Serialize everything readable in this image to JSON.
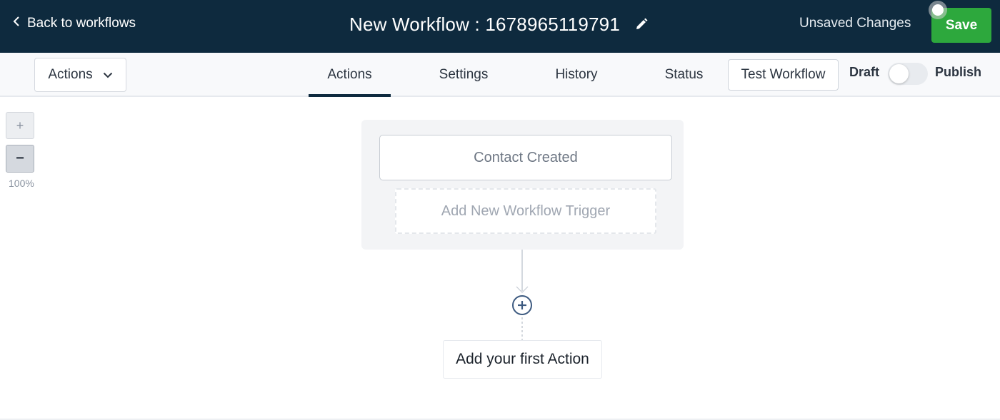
{
  "header": {
    "back_label": "Back to workflows",
    "title": "New Workflow : 1678965119791",
    "unsaved_label": "Unsaved Changes",
    "save_label": "Save"
  },
  "toolbar": {
    "actions_dropdown": "Actions",
    "tabs": [
      {
        "label": "Actions",
        "active": true
      },
      {
        "label": "Settings",
        "active": false
      },
      {
        "label": "History",
        "active": false
      },
      {
        "label": "Status",
        "active": false
      }
    ],
    "test_label": "Test Workflow",
    "draft_label": "Draft",
    "publish_label": "Publish",
    "published": false
  },
  "canvas": {
    "zoom_in_label": "+",
    "zoom_out_label": "−",
    "zoom_level": "100%",
    "trigger": "Contact Created",
    "add_trigger_label": "Add New Workflow Trigger",
    "first_action_label": "Add your first Action"
  },
  "icons": {
    "back": "chevron-left-icon",
    "edit": "pencil-icon",
    "dropdown": "chevron-down-icon",
    "add": "plus-circle-icon"
  },
  "colors": {
    "header_bg": "#0e2a3e",
    "save_green": "#2da83d",
    "active_tab_underline": "#0e2a3e",
    "node_outline": "#3d5a80"
  }
}
